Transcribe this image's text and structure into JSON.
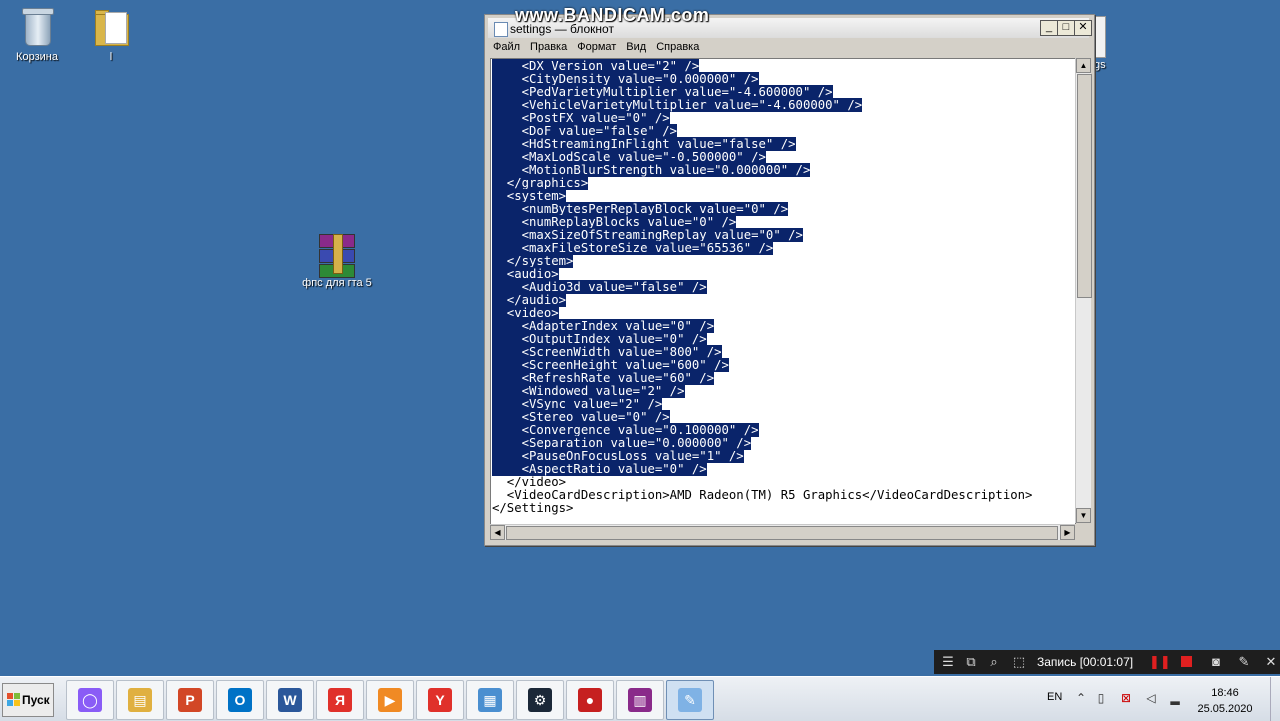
{
  "desktop": {
    "icons": [
      {
        "label": "Корзина"
      },
      {
        "label": "l"
      },
      {
        "label": "фпс для гта 5"
      }
    ],
    "hidden_label_fragment": "gs"
  },
  "watermark": "www.BANDICAM.com",
  "notepad": {
    "title": "settings — блокнот",
    "menu": [
      "Файл",
      "Правка",
      "Формат",
      "Вид",
      "Справка"
    ],
    "lines": [
      {
        "text": "    <DX_Version value=\"2\" />",
        "selected": true
      },
      {
        "text": "    <CityDensity value=\"0.000000\" />",
        "selected": true
      },
      {
        "text": "    <PedVarietyMultiplier value=\"-4.600000\" />",
        "selected": true
      },
      {
        "text": "    <VehicleVarietyMultiplier value=\"-4.600000\" />",
        "selected": true
      },
      {
        "text": "    <PostFX value=\"0\" />",
        "selected": true
      },
      {
        "text": "    <DoF value=\"false\" />",
        "selected": true
      },
      {
        "text": "    <HdStreamingInFlight value=\"false\" />",
        "selected": true
      },
      {
        "text": "    <MaxLodScale value=\"-0.500000\" />",
        "selected": true
      },
      {
        "text": "    <MotionBlurStrength value=\"0.000000\" />",
        "selected": true
      },
      {
        "text": "  </graphics>",
        "selected": true
      },
      {
        "text": "  <system>",
        "selected": true
      },
      {
        "text": "    <numBytesPerReplayBlock value=\"0\" />",
        "selected": true
      },
      {
        "text": "    <numReplayBlocks value=\"0\" />",
        "selected": true
      },
      {
        "text": "    <maxSizeOfStreamingReplay value=\"0\" />",
        "selected": true
      },
      {
        "text": "    <maxFileStoreSize value=\"65536\" />",
        "selected": true
      },
      {
        "text": "  </system>",
        "selected": true
      },
      {
        "text": "  <audio>",
        "selected": true
      },
      {
        "text": "    <Audio3d value=\"false\" />",
        "selected": true
      },
      {
        "text": "  </audio>",
        "selected": true
      },
      {
        "text": "  <video>",
        "selected": true
      },
      {
        "text": "    <AdapterIndex value=\"0\" />",
        "selected": true
      },
      {
        "text": "    <OutputIndex value=\"0\" />",
        "selected": true
      },
      {
        "text": "    <ScreenWidth value=\"800\" />",
        "selected": true
      },
      {
        "text": "    <ScreenHeight value=\"600\" />",
        "selected": true
      },
      {
        "text": "    <RefreshRate value=\"60\" />",
        "selected": true
      },
      {
        "text": "    <Windowed value=\"2\" />",
        "selected": true
      },
      {
        "text": "    <VSync value=\"2\" />",
        "selected": true
      },
      {
        "text": "    <Stereo value=\"0\" />",
        "selected": true
      },
      {
        "text": "    <Convergence value=\"0.100000\" />",
        "selected": true
      },
      {
        "text": "    <Separation value=\"0.000000\" />",
        "selected": true
      },
      {
        "text": "    <PauseOnFocusLoss value=\"1\" />",
        "selected": true
      },
      {
        "text": "    <AspectRatio value=\"0\" />",
        "selected": true
      },
      {
        "text": "  </video>",
        "selected": false
      },
      {
        "text": "  <VideoCardDescription>AMD Radeon(TM) R5 Graphics</VideoCardDescription>",
        "selected": false
      },
      {
        "text": "</Settings>",
        "selected": false
      }
    ]
  },
  "recording": {
    "text": "Запись [00:01:07]"
  },
  "taskbar": {
    "start_label": "Пуск",
    "apps": [
      {
        "name": "yandex-alice",
        "color": "#8a5cf6",
        "glyph": "◯"
      },
      {
        "name": "explorer",
        "color": "#e0b040",
        "glyph": "▤"
      },
      {
        "name": "powerpoint",
        "color": "#d24726",
        "glyph": "P"
      },
      {
        "name": "outlook",
        "color": "#0072c6",
        "glyph": "O"
      },
      {
        "name": "word",
        "color": "#2b579a",
        "glyph": "W"
      },
      {
        "name": "yandex",
        "color": "#e0312b",
        "glyph": "Я"
      },
      {
        "name": "media-player",
        "color": "#f08a24",
        "glyph": "▶"
      },
      {
        "name": "yandex-browser",
        "color": "#e0312b",
        "glyph": "Y"
      },
      {
        "name": "control-panel",
        "color": "#4a8fd0",
        "glyph": "▦"
      },
      {
        "name": "steam",
        "color": "#1b2838",
        "glyph": "⚙"
      },
      {
        "name": "bandicam",
        "color": "#c62020",
        "glyph": "●"
      },
      {
        "name": "winrar",
        "color": "#8a2a8a",
        "glyph": "▥"
      },
      {
        "name": "notepad",
        "color": "#7fb2e5",
        "glyph": "✎"
      }
    ],
    "language": "EN",
    "time": "18:46",
    "date": "25.05.2020"
  }
}
